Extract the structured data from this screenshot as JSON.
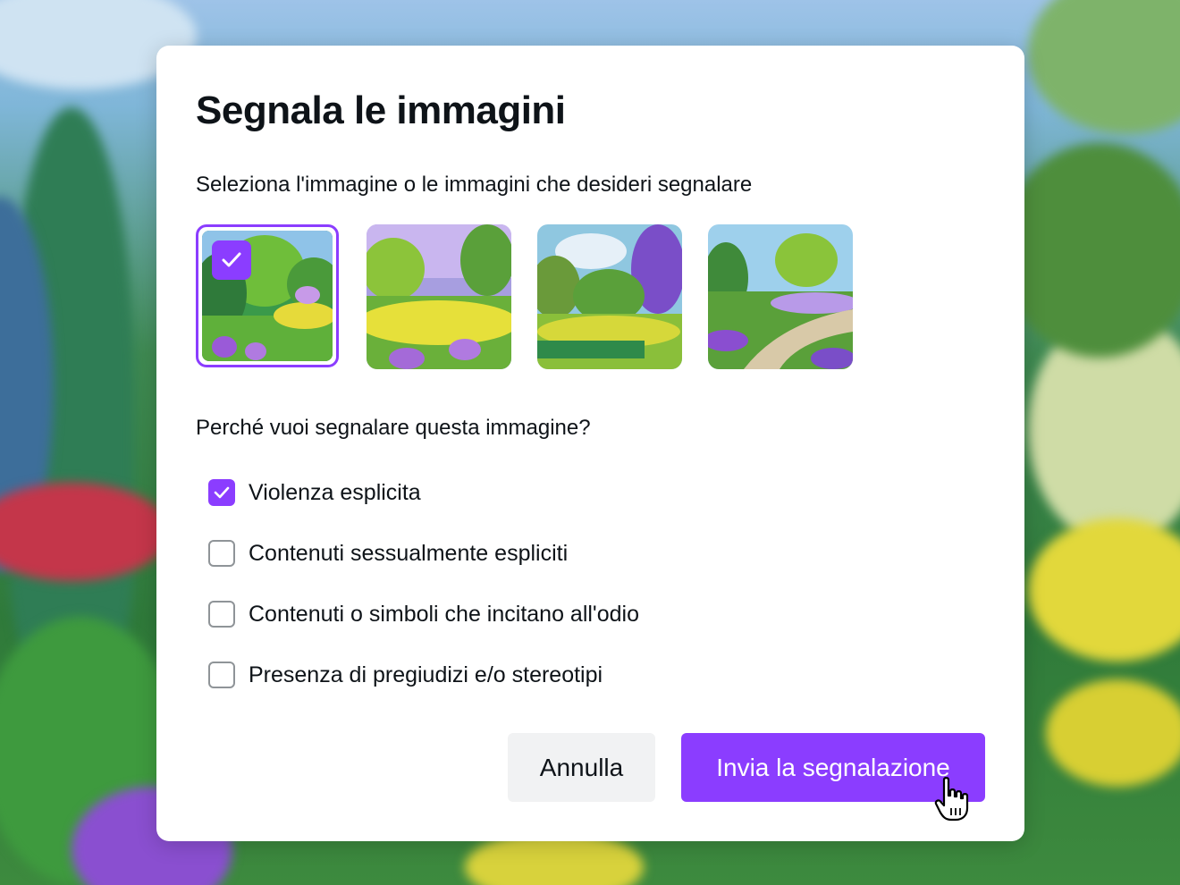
{
  "dialog": {
    "title": "Segnala le immagini",
    "subtitle": "Seleziona l'immagine o le immagini che desideri segnalare",
    "question": "Perché vuoi segnalare questa immagine?"
  },
  "images": [
    {
      "selected": true,
      "icon": "checkmark-icon"
    },
    {
      "selected": false
    },
    {
      "selected": false
    },
    {
      "selected": false
    }
  ],
  "reasons": [
    {
      "label": "Violenza esplicita",
      "checked": true
    },
    {
      "label": "Contenuti sessualmente espliciti",
      "checked": false
    },
    {
      "label": "Contenuti o simboli che incitano all'odio",
      "checked": false
    },
    {
      "label": "Presenza di pregiudizi e/o stereotipi",
      "checked": false
    }
  ],
  "buttons": {
    "cancel_label": "Annulla",
    "submit_label": "Invia la segnalazione"
  },
  "colors": {
    "accent": "#8b3dff",
    "text": "#0e1318",
    "cancel_bg": "#f1f2f3"
  },
  "cursor_icon": "hand-pointer-icon"
}
